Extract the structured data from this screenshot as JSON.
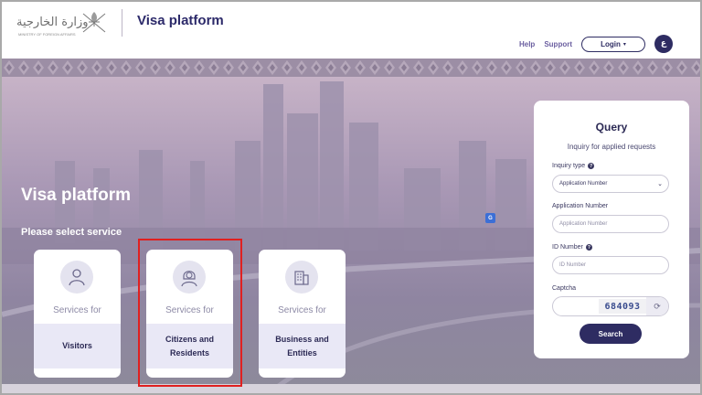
{
  "header": {
    "logo_text": "وزارة الخارجية",
    "logo_subtext": "MINISTRY OF FOREIGN AFFAIRS",
    "app_title": "Visa platform",
    "nav": {
      "help": "Help",
      "support": "Support",
      "login": "Login",
      "language": "ع"
    }
  },
  "hero": {
    "title": "Visa platform",
    "subtitle": "Please select service"
  },
  "services": [
    {
      "top": "Services for",
      "label": "Visitors",
      "icon": "visitor-icon"
    },
    {
      "top": "Services for",
      "label": "Citizens and Residents",
      "icon": "citizen-icon"
    },
    {
      "top": "Services for",
      "label": "Business and Entities",
      "icon": "building-icon"
    }
  ],
  "query": {
    "title": "Query",
    "subtitle": "Inquiry for applied requests",
    "inquiry_type_label": "Inquiry type",
    "inquiry_type_value": "Application Number",
    "application_number_label": "Application Number",
    "application_number_placeholder": "Application Number",
    "id_number_label": "ID Number",
    "id_number_placeholder": "ID Number",
    "captcha_label": "Captcha",
    "captcha_value": "684093",
    "search_label": "Search"
  },
  "colors": {
    "brand": "#2e2c62",
    "highlight": "#e02020"
  }
}
